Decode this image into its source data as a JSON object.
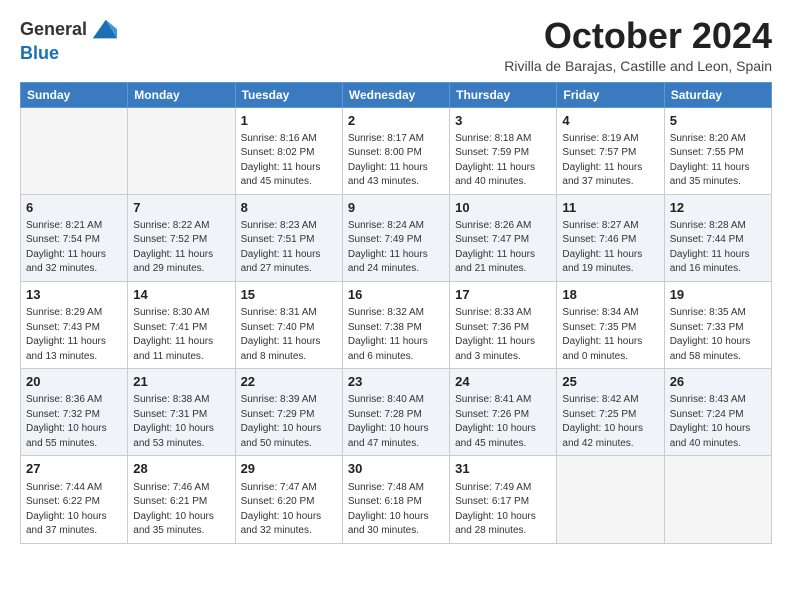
{
  "logo": {
    "general": "General",
    "blue": "Blue"
  },
  "title": "October 2024",
  "subtitle": "Rivilla de Barajas, Castille and Leon, Spain",
  "days": [
    "Sunday",
    "Monday",
    "Tuesday",
    "Wednesday",
    "Thursday",
    "Friday",
    "Saturday"
  ],
  "weeks": [
    [
      {
        "day": "",
        "info": ""
      },
      {
        "day": "",
        "info": ""
      },
      {
        "day": "1",
        "info": "Sunrise: 8:16 AM\nSunset: 8:02 PM\nDaylight: 11 hours and 45 minutes."
      },
      {
        "day": "2",
        "info": "Sunrise: 8:17 AM\nSunset: 8:00 PM\nDaylight: 11 hours and 43 minutes."
      },
      {
        "day": "3",
        "info": "Sunrise: 8:18 AM\nSunset: 7:59 PM\nDaylight: 11 hours and 40 minutes."
      },
      {
        "day": "4",
        "info": "Sunrise: 8:19 AM\nSunset: 7:57 PM\nDaylight: 11 hours and 37 minutes."
      },
      {
        "day": "5",
        "info": "Sunrise: 8:20 AM\nSunset: 7:55 PM\nDaylight: 11 hours and 35 minutes."
      }
    ],
    [
      {
        "day": "6",
        "info": "Sunrise: 8:21 AM\nSunset: 7:54 PM\nDaylight: 11 hours and 32 minutes."
      },
      {
        "day": "7",
        "info": "Sunrise: 8:22 AM\nSunset: 7:52 PM\nDaylight: 11 hours and 29 minutes."
      },
      {
        "day": "8",
        "info": "Sunrise: 8:23 AM\nSunset: 7:51 PM\nDaylight: 11 hours and 27 minutes."
      },
      {
        "day": "9",
        "info": "Sunrise: 8:24 AM\nSunset: 7:49 PM\nDaylight: 11 hours and 24 minutes."
      },
      {
        "day": "10",
        "info": "Sunrise: 8:26 AM\nSunset: 7:47 PM\nDaylight: 11 hours and 21 minutes."
      },
      {
        "day": "11",
        "info": "Sunrise: 8:27 AM\nSunset: 7:46 PM\nDaylight: 11 hours and 19 minutes."
      },
      {
        "day": "12",
        "info": "Sunrise: 8:28 AM\nSunset: 7:44 PM\nDaylight: 11 hours and 16 minutes."
      }
    ],
    [
      {
        "day": "13",
        "info": "Sunrise: 8:29 AM\nSunset: 7:43 PM\nDaylight: 11 hours and 13 minutes."
      },
      {
        "day": "14",
        "info": "Sunrise: 8:30 AM\nSunset: 7:41 PM\nDaylight: 11 hours and 11 minutes."
      },
      {
        "day": "15",
        "info": "Sunrise: 8:31 AM\nSunset: 7:40 PM\nDaylight: 11 hours and 8 minutes."
      },
      {
        "day": "16",
        "info": "Sunrise: 8:32 AM\nSunset: 7:38 PM\nDaylight: 11 hours and 6 minutes."
      },
      {
        "day": "17",
        "info": "Sunrise: 8:33 AM\nSunset: 7:36 PM\nDaylight: 11 hours and 3 minutes."
      },
      {
        "day": "18",
        "info": "Sunrise: 8:34 AM\nSunset: 7:35 PM\nDaylight: 11 hours and 0 minutes."
      },
      {
        "day": "19",
        "info": "Sunrise: 8:35 AM\nSunset: 7:33 PM\nDaylight: 10 hours and 58 minutes."
      }
    ],
    [
      {
        "day": "20",
        "info": "Sunrise: 8:36 AM\nSunset: 7:32 PM\nDaylight: 10 hours and 55 minutes."
      },
      {
        "day": "21",
        "info": "Sunrise: 8:38 AM\nSunset: 7:31 PM\nDaylight: 10 hours and 53 minutes."
      },
      {
        "day": "22",
        "info": "Sunrise: 8:39 AM\nSunset: 7:29 PM\nDaylight: 10 hours and 50 minutes."
      },
      {
        "day": "23",
        "info": "Sunrise: 8:40 AM\nSunset: 7:28 PM\nDaylight: 10 hours and 47 minutes."
      },
      {
        "day": "24",
        "info": "Sunrise: 8:41 AM\nSunset: 7:26 PM\nDaylight: 10 hours and 45 minutes."
      },
      {
        "day": "25",
        "info": "Sunrise: 8:42 AM\nSunset: 7:25 PM\nDaylight: 10 hours and 42 minutes."
      },
      {
        "day": "26",
        "info": "Sunrise: 8:43 AM\nSunset: 7:24 PM\nDaylight: 10 hours and 40 minutes."
      }
    ],
    [
      {
        "day": "27",
        "info": "Sunrise: 7:44 AM\nSunset: 6:22 PM\nDaylight: 10 hours and 37 minutes."
      },
      {
        "day": "28",
        "info": "Sunrise: 7:46 AM\nSunset: 6:21 PM\nDaylight: 10 hours and 35 minutes."
      },
      {
        "day": "29",
        "info": "Sunrise: 7:47 AM\nSunset: 6:20 PM\nDaylight: 10 hours and 32 minutes."
      },
      {
        "day": "30",
        "info": "Sunrise: 7:48 AM\nSunset: 6:18 PM\nDaylight: 10 hours and 30 minutes."
      },
      {
        "day": "31",
        "info": "Sunrise: 7:49 AM\nSunset: 6:17 PM\nDaylight: 10 hours and 28 minutes."
      },
      {
        "day": "",
        "info": ""
      },
      {
        "day": "",
        "info": ""
      }
    ]
  ]
}
